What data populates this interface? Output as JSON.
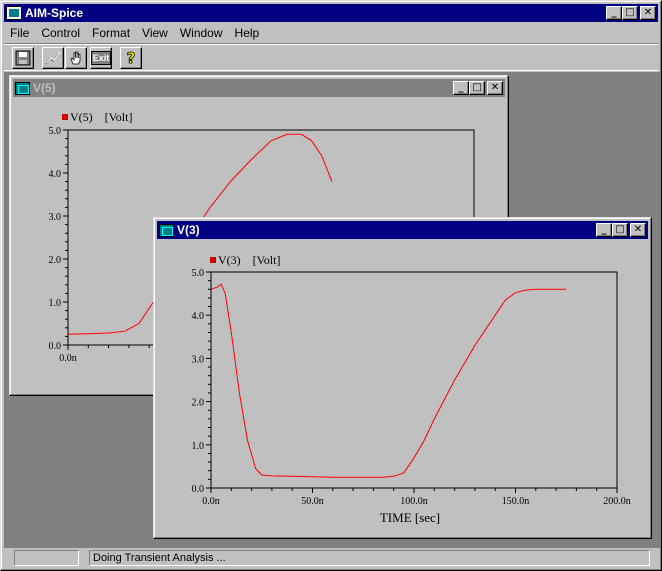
{
  "app": {
    "title": "AIM-Spice",
    "min": "_",
    "max": "□",
    "close": "✕"
  },
  "menu": [
    "File",
    "Control",
    "Format",
    "View",
    "Window",
    "Help"
  ],
  "toolbar": {
    "icons": [
      "save-icon",
      "plot-icon",
      "hand-icon",
      "exit-icon",
      "help-icon"
    ],
    "exit_label": "Exit",
    "help_label": "?"
  },
  "windows": {
    "v5": {
      "title": "V(5)",
      "legend": "V(5)    [Volt]",
      "legend_color": "#cc0000"
    },
    "v3": {
      "title": "V(3)",
      "legend": "V(3)    [Volt]",
      "legend_color": "#cc0000",
      "xlabel": "TIME [sec]"
    }
  },
  "status": {
    "left": "",
    "message": "Doing Transient Analysis ..."
  },
  "chart_data": [
    {
      "type": "line",
      "title": "",
      "ylabel": "",
      "xlabel": "",
      "xlim": [
        0,
        200
      ],
      "ylim": [
        0,
        5
      ],
      "yticks": [
        "0.0",
        "1.0",
        "2.0",
        "3.0",
        "4.0",
        "5.0"
      ],
      "xticks": [
        "0.0n"
      ],
      "line_color": "#ff0000",
      "series": [
        {
          "name": "V(5)",
          "x": [
            0,
            10,
            20,
            28,
            35,
            42,
            50,
            60,
            70,
            80,
            90,
            100,
            108,
            115,
            120,
            125,
            130
          ],
          "y": [
            0.25,
            0.26,
            0.28,
            0.32,
            0.5,
            1.0,
            1.7,
            2.5,
            3.2,
            3.8,
            4.3,
            4.75,
            4.9,
            4.9,
            4.75,
            4.4,
            3.8
          ]
        }
      ]
    },
    {
      "type": "line",
      "title": "",
      "ylabel": "",
      "xlabel": "TIME [sec]",
      "xlim": [
        0,
        200
      ],
      "ylim": [
        0,
        5
      ],
      "yticks": [
        "0.0",
        "1.0",
        "2.0",
        "3.0",
        "4.0",
        "5.0"
      ],
      "xticks": [
        "0.0n",
        "50.0n",
        "100.0n",
        "150.0n",
        "200.0n"
      ],
      "line_color": "#ff0000",
      "series": [
        {
          "name": "V(3)",
          "x": [
            0,
            3,
            5,
            7,
            10,
            14,
            18,
            22,
            25,
            30,
            40,
            50,
            60,
            70,
            80,
            85,
            90,
            95,
            100,
            105,
            110,
            120,
            130,
            140,
            145,
            150,
            155,
            160,
            170,
            175
          ],
          "y": [
            4.6,
            4.65,
            4.72,
            4.5,
            3.6,
            2.2,
            1.1,
            0.45,
            0.3,
            0.28,
            0.27,
            0.26,
            0.25,
            0.25,
            0.25,
            0.25,
            0.27,
            0.35,
            0.7,
            1.1,
            1.6,
            2.5,
            3.3,
            4.0,
            4.35,
            4.52,
            4.58,
            4.6,
            4.6,
            4.6
          ]
        }
      ]
    }
  ]
}
